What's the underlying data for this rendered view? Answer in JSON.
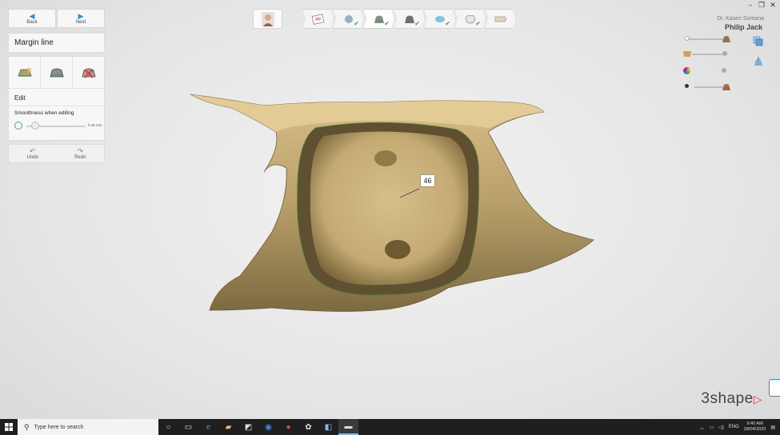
{
  "window": {
    "controls": [
      "–",
      "❐",
      "✕"
    ]
  },
  "nav": {
    "back_label": "Back",
    "next_label": "Next"
  },
  "panel": {
    "title": "Margin line",
    "tools": [
      "auto-margin-tool-icon",
      "margin-view-tool-icon",
      "delete-margin-tool-icon"
    ],
    "edit_label": "Edit",
    "smoothness_label": "Smoothness when editing",
    "smoothness_value": "0.46 mm",
    "smoothness_fraction": 0.15,
    "undo_label": "Undo",
    "redo_label": "Redo"
  },
  "header": {
    "doctor": "Dr. Kasen Somana",
    "patient": "Philip Jack"
  },
  "workflow": {
    "steps": [
      {
        "name": "order-form-icon",
        "done": false
      },
      {
        "name": "scan-icon",
        "done": true
      },
      {
        "name": "margin-line-icon",
        "done": true
      },
      {
        "name": "insertion-icon",
        "done": true
      },
      {
        "name": "cement-gap-icon",
        "done": true
      },
      {
        "name": "crown-design-icon",
        "done": true
      },
      {
        "name": "export-icon",
        "done": false
      }
    ],
    "active_index": 2
  },
  "scene": {
    "tooth_label": "46"
  },
  "brand": {
    "logo_text": "3shape"
  },
  "taskbar": {
    "search_placeholder": "Type here to search",
    "language": "ENG",
    "time": "9:40 AM",
    "date": "28/04/2020"
  },
  "colors": {
    "accent": "#2a8fd6",
    "check": "#43a047",
    "logo_triangle": "#e53935",
    "model": "#c9b27c"
  }
}
